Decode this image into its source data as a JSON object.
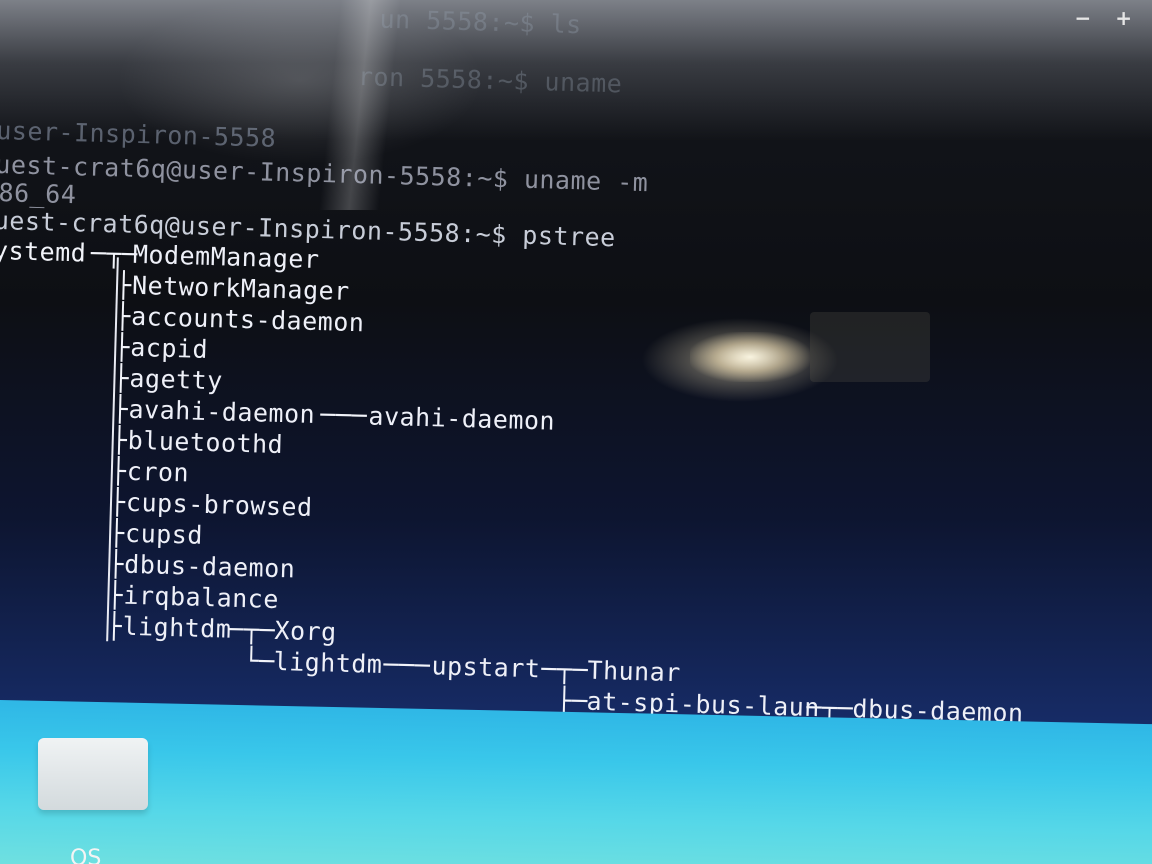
{
  "window": {
    "controls": {
      "minimize": "−",
      "maximize": "+"
    }
  },
  "terminal": {
    "history": [
      "un 5558:~$ ls",
      "ron 5558:~$ uname",
      "user-Inspiron-5558",
      "uest-crat6q@user-Inspiron-5558:~$ uname -m",
      "86_64",
      "uest-crat6q@user-Inspiron-5558:~$ pstree"
    ],
    "tree": {
      "root": "ystemd",
      "children": [
        "ModemManager",
        "NetworkManager",
        "accounts-daemon",
        "acpid",
        "agetty",
        "avahi-daemon",
        "bluetoothd",
        "cron",
        "cups-browsed",
        "cupsd",
        "dbus-daemon",
        "irqbalance",
        "lightdm"
      ],
      "avahi_child": "avahi-daemon",
      "lightdm_children": [
        "Xorg",
        "lightdm"
      ],
      "upstart": "upstart",
      "upstart_children": [
        "Thunar",
        "at-spi-bus-laun"
      ],
      "at_spi_child": "dbus-daemon"
    }
  },
  "desktop": {
    "icon_label": "OS"
  }
}
